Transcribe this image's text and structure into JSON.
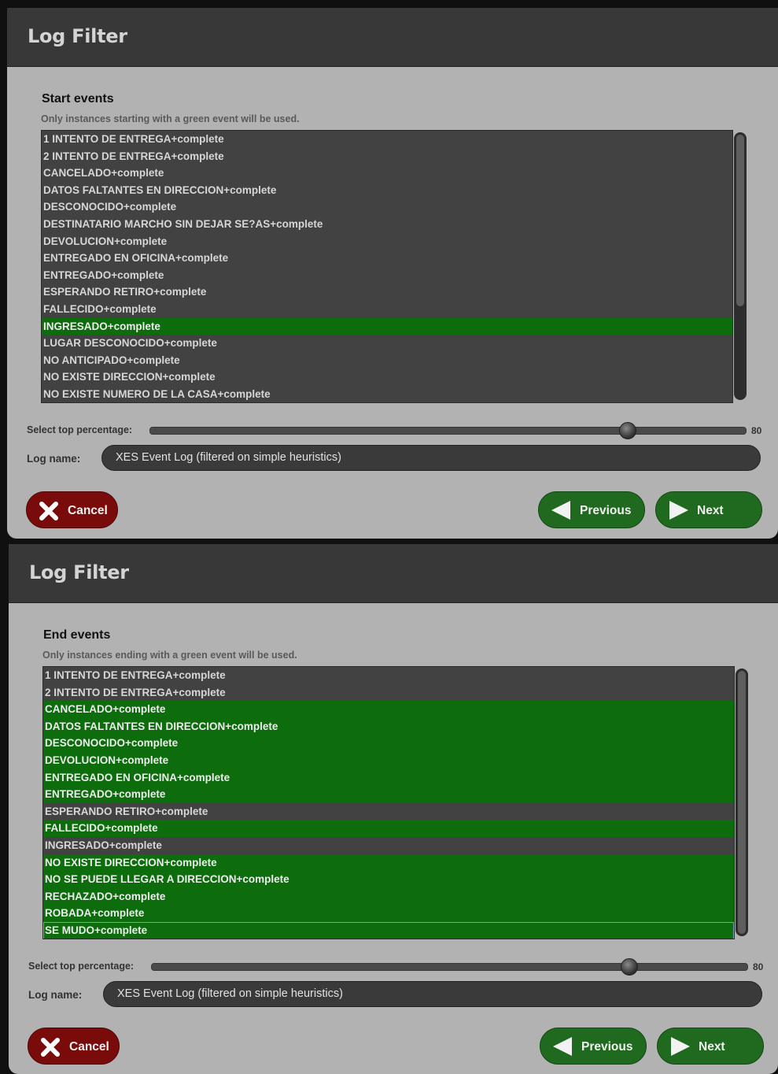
{
  "panels": [
    {
      "title": "Log Filter",
      "section_title": "Start events",
      "section_subtitle": "Only instances starting with a green event will be used.",
      "events": [
        {
          "label": "1 INTENTO DE ENTREGA+complete",
          "selected": false
        },
        {
          "label": "2 INTENTO DE ENTREGA+complete",
          "selected": false
        },
        {
          "label": "CANCELADO+complete",
          "selected": false
        },
        {
          "label": "DATOS FALTANTES EN DIRECCION+complete",
          "selected": false
        },
        {
          "label": "DESCONOCIDO+complete",
          "selected": false
        },
        {
          "label": "DESTINATARIO MARCHO SIN DEJAR SE?AS+complete",
          "selected": false
        },
        {
          "label": "DEVOLUCION+complete",
          "selected": false
        },
        {
          "label": "ENTREGADO EN OFICINA+complete",
          "selected": false
        },
        {
          "label": "ENTREGADO+complete",
          "selected": false
        },
        {
          "label": "ESPERANDO RETIRO+complete",
          "selected": false
        },
        {
          "label": "FALLECIDO+complete",
          "selected": false
        },
        {
          "label": "INGRESADO+complete",
          "selected": true
        },
        {
          "label": "LUGAR DESCONOCIDO+complete",
          "selected": false
        },
        {
          "label": "NO ANTICIPADO+complete",
          "selected": false
        },
        {
          "label": "NO EXISTE DIRECCION+complete",
          "selected": false
        },
        {
          "label": "NO EXISTE NUMERO DE LA CASA+complete",
          "selected": false
        }
      ],
      "focused_index": -1,
      "scroll_position": 0,
      "slider_label": "Select top percentage:",
      "slider_value": "80",
      "log_name_label": "Log name:",
      "log_name_value": "XES Event Log (filtered on simple heuristics)",
      "cancel_label": "Cancel",
      "previous_label": "Previous",
      "next_label": "Next"
    },
    {
      "title": "Log Filter",
      "section_title": "End events",
      "section_subtitle": "Only instances ending with a green event will be used.",
      "events": [
        {
          "label": "1 INTENTO DE ENTREGA+complete",
          "selected": false
        },
        {
          "label": "2 INTENTO DE ENTREGA+complete",
          "selected": false
        },
        {
          "label": "CANCELADO+complete",
          "selected": true
        },
        {
          "label": "DATOS FALTANTES EN DIRECCION+complete",
          "selected": true
        },
        {
          "label": "DESCONOCIDO+complete",
          "selected": true
        },
        {
          "label": "DEVOLUCION+complete",
          "selected": true
        },
        {
          "label": "ENTREGADO EN OFICINA+complete",
          "selected": true
        },
        {
          "label": "ENTREGADO+complete",
          "selected": true
        },
        {
          "label": "ESPERANDO RETIRO+complete",
          "selected": false
        },
        {
          "label": "FALLECIDO+complete",
          "selected": true
        },
        {
          "label": "INGRESADO+complete",
          "selected": false
        },
        {
          "label": "NO EXISTE DIRECCION+complete",
          "selected": true
        },
        {
          "label": "NO SE PUEDE LLEGAR A DIRECCION+complete",
          "selected": true
        },
        {
          "label": "RECHAZADO+complete",
          "selected": true
        },
        {
          "label": "ROBADA+complete",
          "selected": true
        },
        {
          "label": "SE MUDO+complete",
          "selected": true
        }
      ],
      "focused_index": 15,
      "scroll_position": 0,
      "slider_label": "Select top percentage:",
      "slider_value": "80",
      "log_name_label": "Log name:",
      "log_name_value": "XES Event Log (filtered on simple heuristics)",
      "cancel_label": "Cancel",
      "previous_label": "Previous",
      "next_label": "Next"
    }
  ],
  "colors": {
    "selected_green": "#0d6d0d",
    "list_background": "#424242",
    "cancel_red": "#7a0b0b",
    "nav_green": "#1f6a1f"
  },
  "icons": {
    "cancel": "x-icon",
    "previous": "arrow-left-icon",
    "next": "arrow-right-icon"
  }
}
